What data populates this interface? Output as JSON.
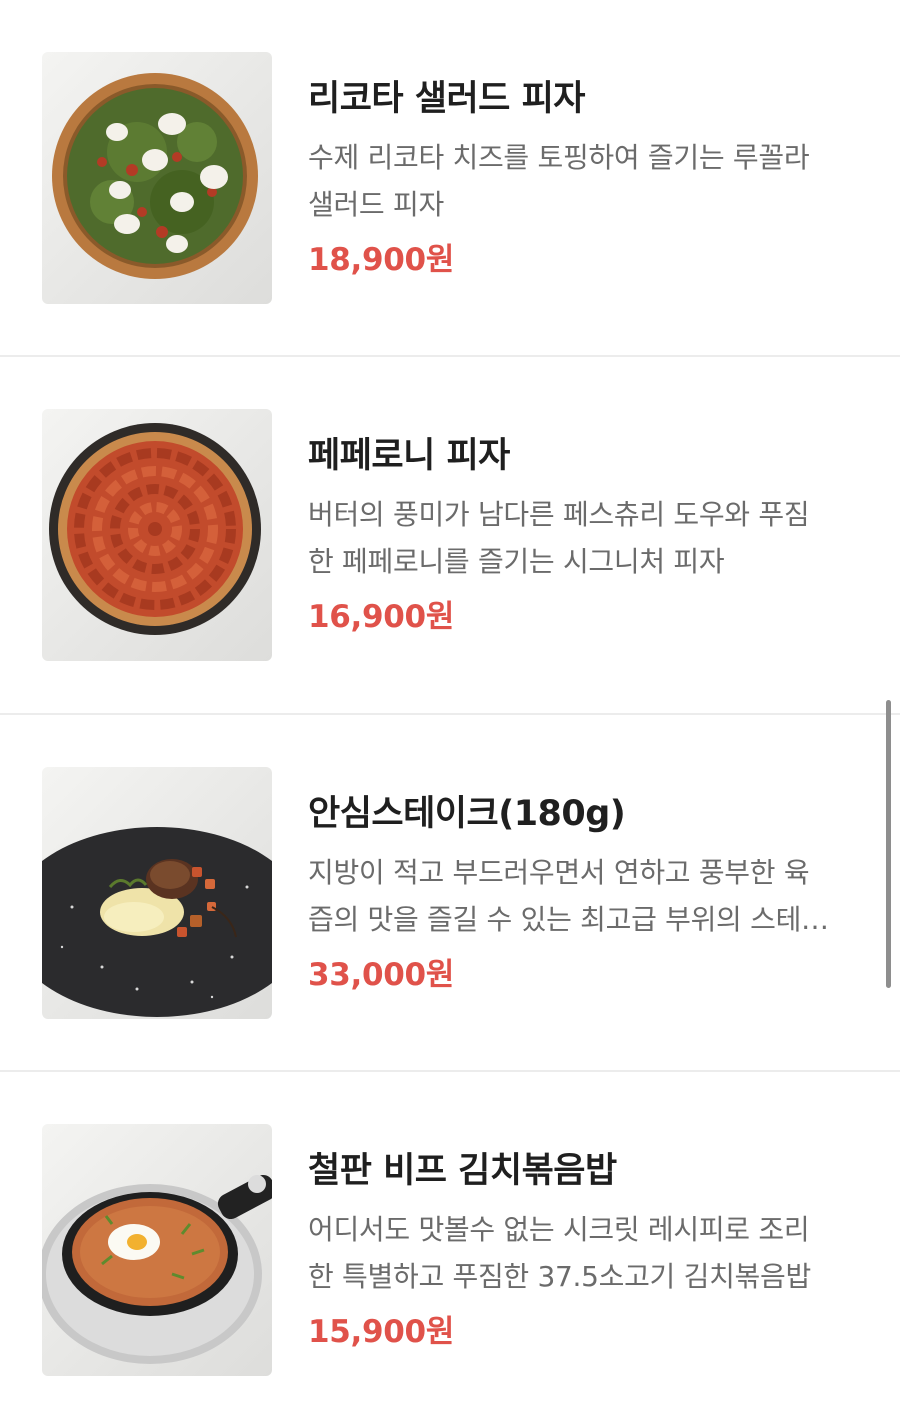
{
  "menu": {
    "items": [
      {
        "name": "리코타 샐러드 피자",
        "desc_lines": [
          "수제 리코타 치즈를 토핑하여 즐기는 루꼴라",
          "샐러드 피자"
        ],
        "price": "18,900원",
        "image": "ricotta-salad-pizza-photo"
      },
      {
        "name": "페페로니 피자",
        "desc_lines": [
          "버터의 풍미가 남다른 페스츄리 도우와 푸짐",
          "한 페페로니를 즐기는 시그니처 피자"
        ],
        "price": "16,900원",
        "image": "pepperoni-pizza-photo"
      },
      {
        "name": "안심스테이크(180g)",
        "desc_lines": [
          "지방이 적고 부드러우면서 연하고 풍부한 육",
          "즙의 맛을 즐길 수 있는 최고급 부위의 스테…"
        ],
        "price": "33,000원",
        "image": "tenderloin-steak-photo"
      },
      {
        "name": "철판 비프 김치볶음밥",
        "desc_lines": [
          "어디서도 맛볼수 없는 시크릿 레시피로 조리",
          "한 특별하고 푸짐한 37.5소고기 김치볶음밥"
        ],
        "price": "15,900원",
        "image": "beef-kimchi-fried-rice-photo"
      }
    ]
  },
  "colors": {
    "price": "#e0524a",
    "title": "#1f1f1f",
    "description": "#6b6b6b",
    "divider": "#ececec",
    "scrollbar": "#8e8e8e"
  }
}
